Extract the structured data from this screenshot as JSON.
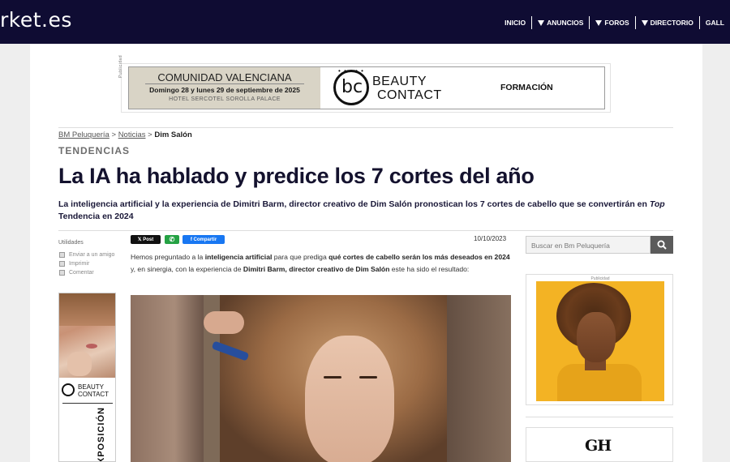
{
  "header": {
    "logo_text": "rket.es",
    "nav": [
      {
        "label": "INICIO",
        "dropdown": false
      },
      {
        "label": "ANUNCIOS",
        "dropdown": true
      },
      {
        "label": "FOROS",
        "dropdown": true
      },
      {
        "label": "DIRECTORIO",
        "dropdown": true
      },
      {
        "label": "GALL",
        "dropdown": false
      }
    ]
  },
  "top_ad": {
    "publicidad": "Publicidad",
    "event_title": "COMUNIDAD VALENCIANA",
    "event_dates": "Domingo 28 y lunes 29 de septiembre de 2025",
    "event_venue": "HOTEL SERCOTEL SOROLLA PALACE",
    "brand_mark": "bc",
    "brand_line1": "BEAUTY",
    "brand_line2": "CONTACT",
    "cta": "FORMACIÓN"
  },
  "breadcrumb": {
    "home": "BM Peluquería",
    "sep1": ">",
    "section": "Noticias",
    "sep2": ">",
    "current": "Dim Salón"
  },
  "article": {
    "kicker": "TENDENCIAS",
    "title": "La IA ha hablado y predice los 7 cortes del año",
    "subtitle_part1": "La inteligencia artificial y la experiencia de Dimitri Barm, director creativo de Dim Salón pronostican los 7 cortes de cabello que se convertirán en ",
    "subtitle_italic": "Top",
    "subtitle_part2": " Tendencia en 2024",
    "date": "10/10/2023",
    "body": [
      {
        "text": "Hemos preguntado a la ",
        "bold": false
      },
      {
        "text": "inteligencia artificial",
        "bold": true
      },
      {
        "text": " para que prediga ",
        "bold": false
      },
      {
        "text": "qué cortes de cabello serán los más deseados en 2024",
        "bold": true
      },
      {
        "text": " y, en sinergia, con la experiencia de ",
        "bold": false
      },
      {
        "text": "Dimitri Barm, director creativo de Dim Salón",
        "bold": true
      },
      {
        "text": " este ha sido el resultado:",
        "bold": false
      }
    ]
  },
  "share": {
    "x_label": "𝕏 Post",
    "whatsapp_label": "✆",
    "facebook_label": "f Compartir"
  },
  "utilities": {
    "title": "Utilidades",
    "items": [
      "Enviar a un amigo",
      "Imprimir",
      "Comentar"
    ]
  },
  "left_ad": {
    "brand_line1": "BEAUTY",
    "brand_line2": "CONTACT",
    "vertical_text": "EXPOSICIÓN"
  },
  "search": {
    "placeholder": "Buscar en  Bm Peluquería",
    "icon": "search-icon"
  },
  "right_ad": {
    "publicidad": "Publicidad"
  },
  "right_ad2": {
    "logo": "GH"
  },
  "colors": {
    "header_bg": "#0f0c33",
    "title": "#14122e",
    "x_button": "#111111",
    "whatsapp": "#25a244",
    "facebook": "#1877f2"
  }
}
